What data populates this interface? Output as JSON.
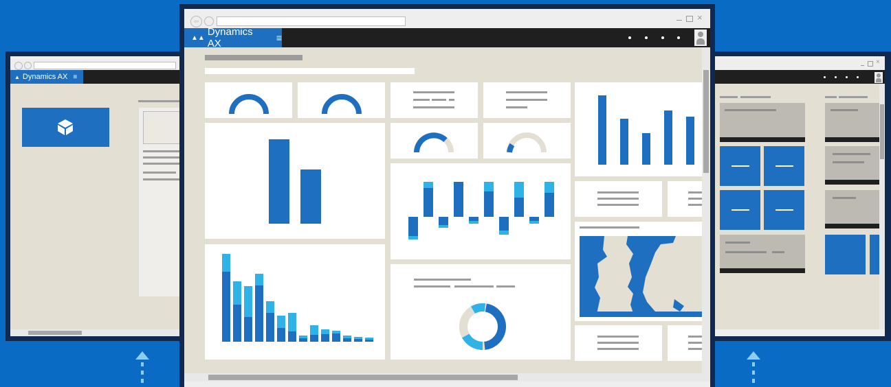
{
  "app": {
    "title": "Dynamics AX"
  },
  "left_window": {
    "title": "Dynamics AX"
  },
  "center_window": {
    "title": "Dynamics AX",
    "menu_icon": "hamburger-icon",
    "user_icon": "user-icon"
  },
  "colors": {
    "background": "#0a6bc4",
    "frame": "#11284f",
    "accent": "#1e6fbf",
    "light_accent": "#2fb2e6",
    "content": "#e3dfd3"
  }
}
